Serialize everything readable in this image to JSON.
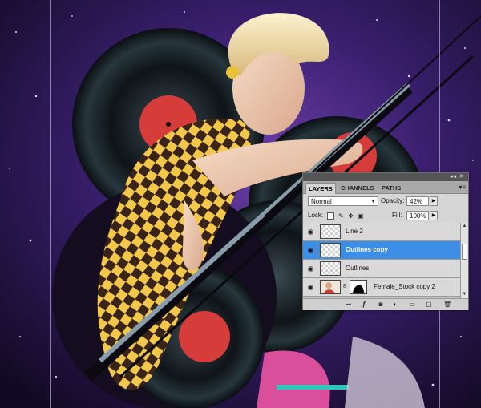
{
  "colors": {
    "accent": "#3d8ee6",
    "panel_bg": "#d6d6d6"
  },
  "layers_panel": {
    "tabs": [
      {
        "label": "LAYERS",
        "active": true
      },
      {
        "label": "CHANNELS",
        "active": false
      },
      {
        "label": "PATHS",
        "active": false
      }
    ],
    "blend_mode": "Normal",
    "opacity_label": "Opacity:",
    "opacity_value": "42%",
    "lock_label": "Lock:",
    "fill_label": "Fill:",
    "fill_value": "100%",
    "layers": [
      {
        "name": "Line 2",
        "visible": true,
        "selected": false
      },
      {
        "name": "Outlines copy",
        "visible": true,
        "selected": true
      },
      {
        "name": "Outlines",
        "visible": true,
        "selected": false
      },
      {
        "name": "Female_Stock copy 2",
        "visible": true,
        "selected": false,
        "has_mask": true
      }
    ],
    "footer_icons": [
      "link-icon",
      "fx-icon",
      "add-mask-icon",
      "adjustment-icon",
      "group-folder-icon",
      "new-layer-icon",
      "trash-icon"
    ]
  }
}
